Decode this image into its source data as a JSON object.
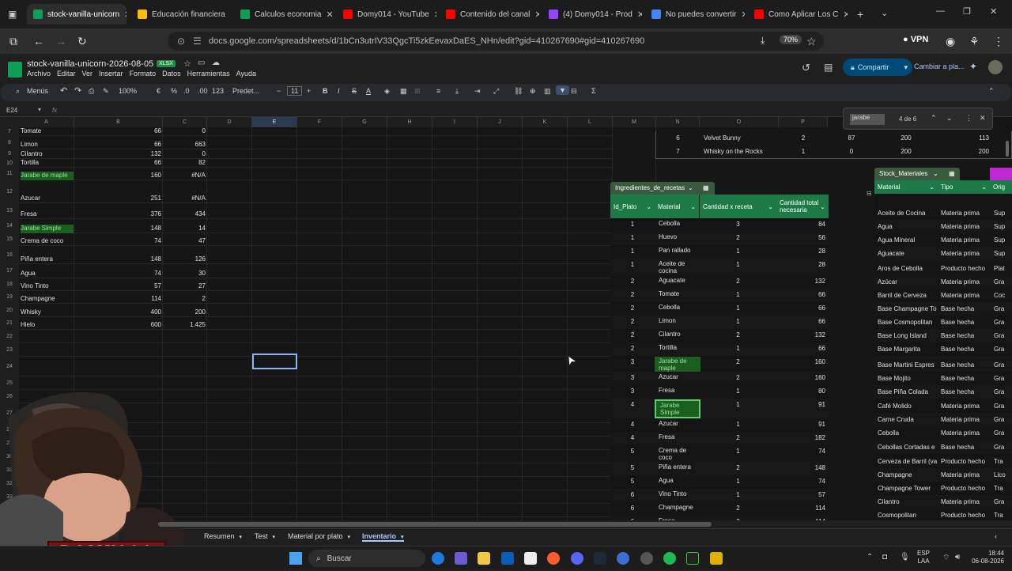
{
  "browser": {
    "tabs": [
      {
        "label": "stock-vanilla-unicorn",
        "color": "#0f9d58",
        "active": true
      },
      {
        "label": "Educación financiera",
        "color": "#fbbc04"
      },
      {
        "label": "Calculos economia",
        "color": "#0f9d58"
      },
      {
        "label": "Domy014 - YouTube",
        "color": "#ff0000"
      },
      {
        "label": "Contenido del canal",
        "color": "#ff0000"
      },
      {
        "label": "(4) Domy014 - Prod",
        "color": "#9146ff"
      },
      {
        "label": "No puedes convertir",
        "color": "#4285f4"
      },
      {
        "label": "Como Aplicar Los C",
        "color": "#ff0000"
      }
    ],
    "url": "docs.google.com/spreadsheets/d/1bCn3utrIV33QgcTi5zkEevaxDaES_NHn/edit?gid=410267690#gid=410267690",
    "zoom_badge": "70%",
    "vpn_label": "VPN"
  },
  "doc": {
    "title": "stock-vanilla-unicorn-2026-08-05",
    "badge": "XLSX",
    "menus": [
      "Archivo",
      "Editar",
      "Ver",
      "Insertar",
      "Formato",
      "Datos",
      "Herramientas",
      "Ayuda"
    ],
    "share_label": "Compartir",
    "switch_label": "Cambiar a pla..."
  },
  "toolbar": {
    "menus_label": "Menús",
    "zoom": "100%",
    "currency": "€",
    "percent": "%",
    "dec_less": ".0",
    "dec_more": ".00",
    "num_format": "123",
    "font": "Predet...",
    "font_size": "11"
  },
  "formula": {
    "cell_ref": "E24",
    "fx": "fx"
  },
  "columns_left": [
    "A",
    "B",
    "C",
    "D",
    "E",
    "F",
    "G",
    "H",
    "I",
    "J",
    "K",
    "L",
    "M"
  ],
  "columns_right": [
    "N",
    "O",
    "P"
  ],
  "left_rows": [
    {
      "n": "7",
      "name": "Tomate",
      "b": "66",
      "c": "0"
    },
    {
      "n": "8",
      "name": "Limon",
      "b": "66",
      "c": "663"
    },
    {
      "n": "9",
      "name": "Cilantro",
      "b": "132",
      "c": "0"
    },
    {
      "n": "10",
      "name": "Tortilla",
      "b": "66",
      "c": "82"
    },
    {
      "n": "11",
      "name": "Jarabe de maple",
      "b": "160",
      "c": "#N/A",
      "green": true
    },
    {
      "n": "12",
      "name": "Azucar",
      "b": "251",
      "c": "#N/A"
    },
    {
      "n": "13",
      "name": "Fresa",
      "b": "376",
      "c": "434"
    },
    {
      "n": "14",
      "name": "Jarabe Simple",
      "b": "148",
      "c": "14",
      "green": true
    },
    {
      "n": "15",
      "name": "Crema de coco",
      "b": "74",
      "c": "47"
    },
    {
      "n": "16",
      "name": "Piña entera",
      "b": "148",
      "c": "126"
    },
    {
      "n": "17",
      "name": "Agua",
      "b": "74",
      "c": "30"
    },
    {
      "n": "18",
      "name": "Vino Tinto",
      "b": "57",
      "c": "27"
    },
    {
      "n": "19",
      "name": "Champagne",
      "b": "114",
      "c": "2"
    },
    {
      "n": "20",
      "name": "Whisky",
      "b": "400",
      "c": "200"
    },
    {
      "n": "21",
      "name": "Hielo",
      "b": "600",
      "c": "1.425"
    }
  ],
  "extra_row_numbers": [
    "22",
    "23",
    "24",
    "25",
    "26",
    "27",
    "28",
    "29",
    "30",
    "31",
    "32",
    "33",
    "34",
    "35"
  ],
  "top_right_rows": [
    {
      "a": "6",
      "b": "Velvet Bunny",
      "c": "2",
      "d": "87",
      "e": "200",
      "f": "113"
    },
    {
      "a": "7",
      "b": "Whisky on the Rocks",
      "c": "1",
      "d": "0",
      "e": "200",
      "f": "200"
    }
  ],
  "find": {
    "count": "4 de 6",
    "query": "jarabe"
  },
  "ingredientes": {
    "name": "Ingredientes_de_recetas",
    "headers": [
      "Id_Plato",
      "Material",
      "Cantidad x receta",
      "Cantidad total necesaria"
    ],
    "rows": [
      [
        "1",
        "Cebolla",
        "3",
        "84"
      ],
      [
        "1",
        "Huevo",
        "2",
        "56"
      ],
      [
        "1",
        "Pan rallado",
        "1",
        "28"
      ],
      [
        "1",
        "Aceite de cocina",
        "1",
        "28"
      ],
      [
        "2",
        "Aguacate",
        "2",
        "132"
      ],
      [
        "2",
        "Tomate",
        "1",
        "66"
      ],
      [
        "2",
        "Cebolla",
        "1",
        "66"
      ],
      [
        "2",
        "Limon",
        "1",
        "66"
      ],
      [
        "2",
        "Cilantro",
        "2",
        "132"
      ],
      [
        "2",
        "Tortilla",
        "1",
        "66"
      ],
      [
        "3",
        "Jarabe de maple",
        "2",
        "160"
      ],
      [
        "3",
        "Azucar",
        "2",
        "160"
      ],
      [
        "3",
        "Fresa",
        "1",
        "80"
      ],
      [
        "4",
        "Jarabe Simple",
        "1",
        "91"
      ],
      [
        "4",
        "Azucar",
        "1",
        "91"
      ],
      [
        "4",
        "Fresa",
        "2",
        "182"
      ],
      [
        "5",
        "Crema de coco",
        "1",
        "74"
      ],
      [
        "5",
        "Piña entera",
        "2",
        "148"
      ],
      [
        "5",
        "Agua",
        "1",
        "74"
      ],
      [
        "6",
        "Vino Tinto",
        "1",
        "57"
      ],
      [
        "6",
        "Champagne",
        "2",
        "114"
      ],
      [
        "6",
        "Fresa",
        "2",
        "114"
      ]
    ]
  },
  "stock": {
    "name": "Stock_Materiales",
    "headers": [
      "Material",
      "Tipo",
      "Orig"
    ],
    "rows": [
      [
        "Aceite de Cocina",
        "Materia prima",
        "Sup"
      ],
      [
        "Agua",
        "Materia prima",
        "Sup"
      ],
      [
        "Agua Mineral",
        "Materia prima",
        "Sup"
      ],
      [
        "Aguacate",
        "Materia prima",
        "Sup"
      ],
      [
        "Aros de Cebolla",
        "Producto hecho",
        "Plat"
      ],
      [
        "Azúcar",
        "Materia prima",
        "Gra"
      ],
      [
        "Barril de Cerveza",
        "Materia prima",
        "Coc"
      ],
      [
        "Base Champagne To",
        "Base hecha",
        "Gra"
      ],
      [
        "Base Cosmopolitan",
        "Base hecha",
        "Gra"
      ],
      [
        "Base Long Island",
        "Base hecha",
        "Gra"
      ],
      [
        "Base Margarita",
        "Base hecha",
        "Gra"
      ],
      [
        "Base Martini Espres",
        "Base hecha",
        "Gra"
      ],
      [
        "Base Mojito",
        "Base hecha",
        "Gra"
      ],
      [
        "Base Piña Colada",
        "Base hecha",
        "Gra"
      ],
      [
        "Café Molido",
        "Materia prima",
        "Gra"
      ],
      [
        "Carne Cruda",
        "Materia prima",
        "Gra"
      ],
      [
        "Cebolla",
        "Materia prima",
        "Gra"
      ],
      [
        "Cebollas Cortadas e",
        "Base hecha",
        "Gra"
      ],
      [
        "Cerveza de Barril (va",
        "Producto hecho",
        "Tra"
      ],
      [
        "Champagne",
        "Materia prima",
        "Lico"
      ],
      [
        "Champagne Tower",
        "Producto hecho",
        "Tra"
      ],
      [
        "Cilantro",
        "Materia prima",
        "Gra"
      ],
      [
        "Cosmopolitan",
        "Producto hecho",
        "Tra"
      ]
    ]
  },
  "sheet_tabs": [
    "Resumen",
    "Test",
    "Material por plato",
    "Inventario"
  ],
  "taskbar": {
    "search": "Buscar",
    "lang1": "ESP",
    "lang2": "LAA",
    "time": "18:44",
    "date": "06-08-2026"
  },
  "streamer_name": "DOMY014"
}
